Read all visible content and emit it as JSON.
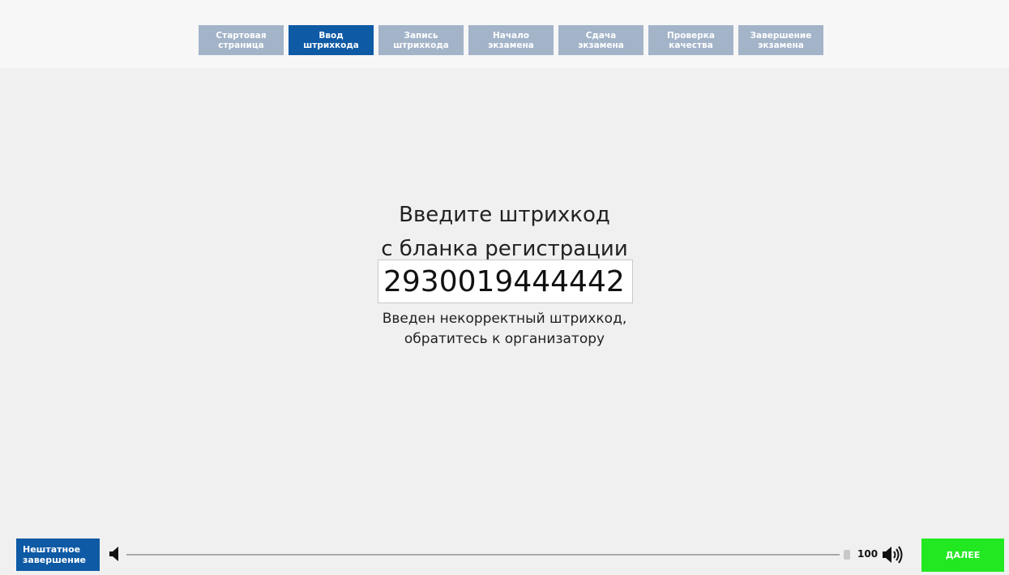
{
  "steps": [
    {
      "line1": "Стартовая",
      "line2": "страница",
      "active": false
    },
    {
      "line1": "Ввод",
      "line2": "штрихкода",
      "active": true
    },
    {
      "line1": "Запись",
      "line2": "штрихкода",
      "active": false
    },
    {
      "line1": "Начало",
      "line2": "экзамена",
      "active": false
    },
    {
      "line1": "Сдача",
      "line2": "экзамена",
      "active": false
    },
    {
      "line1": "Проверка",
      "line2": "качества",
      "active": false
    },
    {
      "line1": "Завершение",
      "line2": "экзамена",
      "active": false
    }
  ],
  "main": {
    "title_line1": "Введите штрихкод",
    "title_line2": "с бланка регистрации",
    "barcode_value": "2930019444442",
    "error_line1": "Введен некорректный штрихкод,",
    "error_line2": "обратитесь к организатору"
  },
  "footer": {
    "abort_line1": "Нештатное",
    "abort_line2": "завершение",
    "volume_value": "100",
    "volume_level": 1.0,
    "next_label": "ДАЛЕЕ"
  },
  "colors": {
    "active_step": "#0e5aa5",
    "inactive_step": "#a3b4c9",
    "next_button": "#21e821",
    "background": "#f0f0f0"
  },
  "icons": {
    "volume_low": "speaker-low-icon",
    "volume_high": "speaker-high-icon"
  }
}
